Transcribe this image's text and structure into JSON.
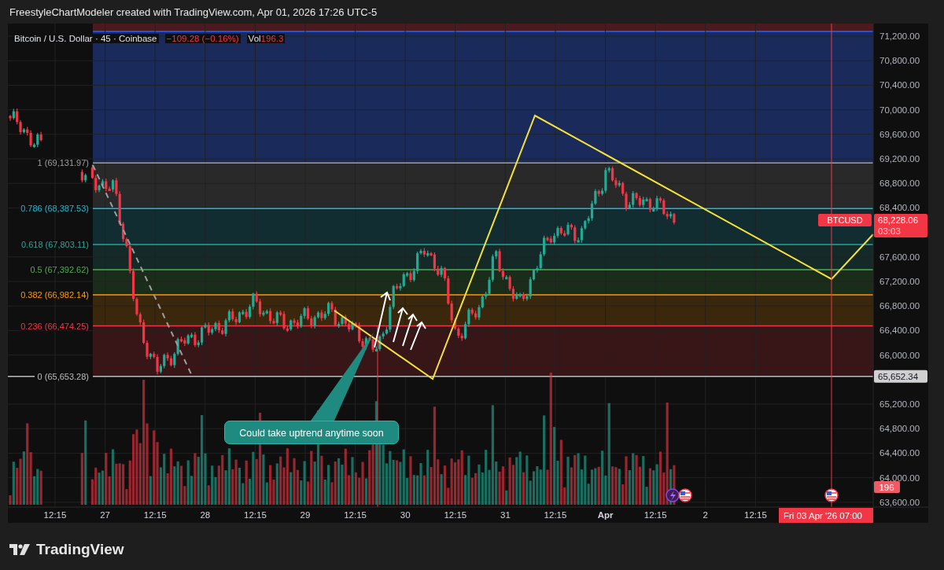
{
  "header": {
    "title": "FreestyleChartModeler created with TradingView.com, Apr 01, 2026 17:26 UTC-5"
  },
  "legend": {
    "symbol": "Bitcoin / U.S. Dollar · 45 · Coinbase",
    "change": "−109.28 (−0.16%)",
    "volume_label": "Vol",
    "volume_value": "196.3"
  },
  "fib_levels": [
    {
      "label": "1 (69,131.97)",
      "color": "#9e9e9e"
    },
    {
      "label": "0.786 (68,387.53)",
      "color": "#22b8cf"
    },
    {
      "label": "0.618 (67,803.11)",
      "color": "#26a69a"
    },
    {
      "label": "0.5 (67,392.62)",
      "color": "#4caf50"
    },
    {
      "label": "0.382 (66,982.14)",
      "color": "#ff9800"
    },
    {
      "label": "0.236 (66,474.25)",
      "color": "#f23645"
    },
    {
      "label": "0 (65,653.28)",
      "color": "#bdbdbd"
    }
  ],
  "price_axis": [
    "71,200.00",
    "70,800.00",
    "70,400.00",
    "70,000.00",
    "69,600.00",
    "69,200.00",
    "68,800.00",
    "68,400.00",
    "67,600.00",
    "67,200.00",
    "66,800.00",
    "66,400.00",
    "66,000.00",
    "65,200.00",
    "64,800.00",
    "64,400.00",
    "64,000.00",
    "63,600.00"
  ],
  "price_tags": {
    "symbol": "BTCUSD",
    "last_price": "68,228.06",
    "countdown": "03:03",
    "fib_zero_price": "65,652.34",
    "volume": "196"
  },
  "time_axis": [
    {
      "text": "12:15",
      "kind": "time"
    },
    {
      "text": "27",
      "kind": "day"
    },
    {
      "text": "12:15",
      "kind": "time"
    },
    {
      "text": "28",
      "kind": "day"
    },
    {
      "text": "12:15",
      "kind": "time"
    },
    {
      "text": "29",
      "kind": "day"
    },
    {
      "text": "12:15",
      "kind": "time"
    },
    {
      "text": "30",
      "kind": "day"
    },
    {
      "text": "12:15",
      "kind": "time"
    },
    {
      "text": "31",
      "kind": "day"
    },
    {
      "text": "12:15",
      "kind": "time"
    },
    {
      "text": "Apr",
      "kind": "month"
    },
    {
      "text": "12:15",
      "kind": "time"
    },
    {
      "text": "2",
      "kind": "day"
    },
    {
      "text": "12:15",
      "kind": "time"
    }
  ],
  "cursor_time": {
    "date": "Fri 03 Apr '26",
    "time": "07:00"
  },
  "annotation": {
    "text": "Could take uptrend anytime soon"
  },
  "footer": {
    "logo": "TradingView"
  }
}
